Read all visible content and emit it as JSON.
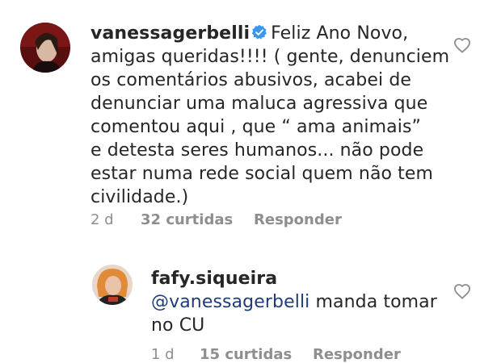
{
  "comments": [
    {
      "username": "vanessagerbelli",
      "verified": true,
      "text_line1": "Feliz Ano Novo,",
      "text_lines": [
        "amigas queridas!!!! ( gente, denunciem",
        "os comentários abusivos, acabei de",
        "denunciar uma maluca agressiva que",
        "comentou aqui , que “ ama animais”",
        "e detesta seres humanos... não pode",
        "estar numa rede social quem não tem",
        "civilidade.)"
      ],
      "time": "2 d",
      "likes": "32 curtidas",
      "reply": "Responder"
    },
    {
      "username": "fafy.siqueira",
      "mention": "@vanessagerbelli",
      "text_line1_rest": " manda tomar",
      "text_line2": "no CU",
      "time": "1 d",
      "likes": "15 curtidas",
      "reply": "Responder"
    }
  ],
  "icons": {
    "verified": "verified-badge-icon",
    "like": "heart-outline-icon"
  },
  "colors": {
    "verified_blue": "#3897f0",
    "meta_gray": "#8e8e8e",
    "mention_blue": "#1f3c7a"
  }
}
